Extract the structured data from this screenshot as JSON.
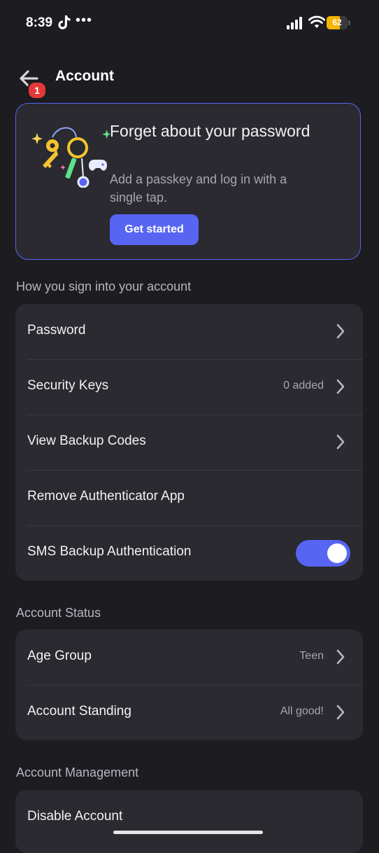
{
  "status_bar": {
    "time": "8:39",
    "battery": "62",
    "battery_level": 0.62,
    "more": "•••"
  },
  "header": {
    "title": "Account",
    "back_badge": "1"
  },
  "promo": {
    "title": "Forget about your password",
    "description": "Add a passkey and log in with a single tap.",
    "button_label": "Get started"
  },
  "sign_in": {
    "label": "How you sign into your account",
    "rows": [
      {
        "label": "Password",
        "value": ""
      },
      {
        "label": "Security Keys",
        "value": "0 added"
      },
      {
        "label": "View Backup Codes",
        "value": ""
      },
      {
        "label": "Remove Authenticator App",
        "value": ""
      },
      {
        "label": "SMS Backup Authentication",
        "toggle_on": true
      }
    ]
  },
  "account_status": {
    "label": "Account Status",
    "rows": [
      {
        "label": "Age Group",
        "value": "Teen"
      },
      {
        "label": "Account Standing",
        "value": "All good!"
      }
    ]
  },
  "account_management": {
    "label": "Account Management",
    "rows": [
      {
        "label": "Disable Account"
      }
    ]
  },
  "colors": {
    "accent": "#5865f2",
    "background": "#1c1c21",
    "card": "#2a2a30",
    "badge": "#e5383b",
    "battery": "#f4b400"
  }
}
